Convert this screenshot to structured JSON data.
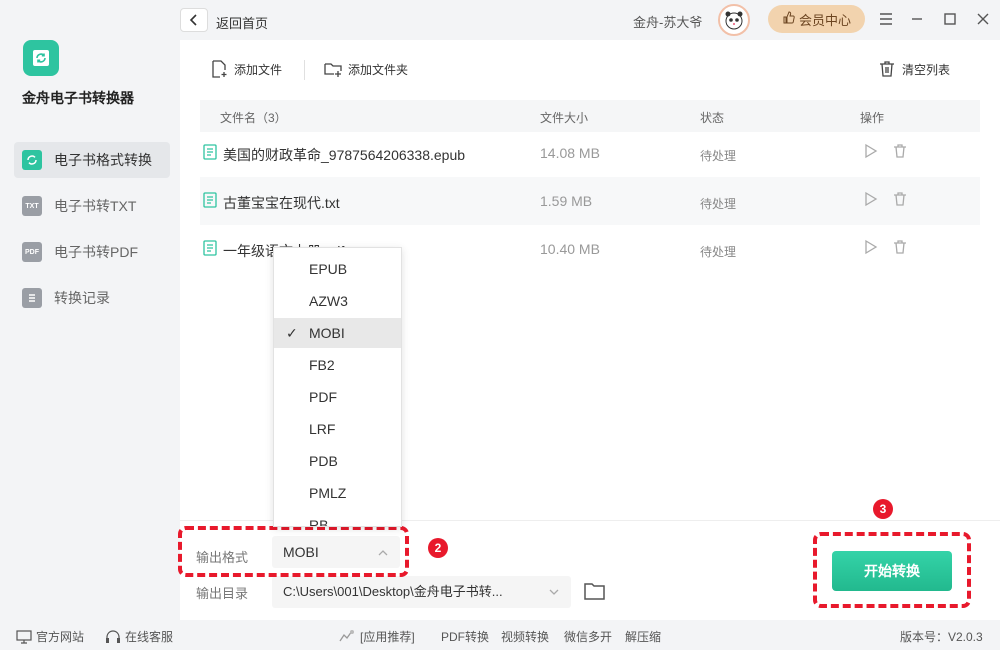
{
  "app": {
    "name": "金舟电子书转换器"
  },
  "sidebar": {
    "items": [
      {
        "label": "电子书格式转换",
        "icon": "refresh-icon",
        "active": true
      },
      {
        "label": "电子书转TXT",
        "icon": "txt-icon",
        "badge": "TXT"
      },
      {
        "label": "电子书转PDF",
        "icon": "pdf-icon",
        "badge": "PDF"
      },
      {
        "label": "转换记录",
        "icon": "history-icon"
      }
    ]
  },
  "topbar": {
    "back_label": "返回首页",
    "username": "金舟-苏大爷",
    "vip_label": "会员中心"
  },
  "toolbar": {
    "add_file": "添加文件",
    "add_folder": "添加文件夹",
    "clear_list": "清空列表"
  },
  "table": {
    "headers": {
      "name": "文件名（3）",
      "size": "文件大小",
      "status": "状态",
      "ops": "操作"
    },
    "rows": [
      {
        "name": "美国的财政革命_9787564206338.epub",
        "size": "14.08 MB",
        "status": "待处理"
      },
      {
        "name": "古董宝宝在现代.txt",
        "size": "1.59 MB",
        "status": "待处理"
      },
      {
        "name": "一年级语文上册.pdf",
        "size": "10.40 MB",
        "status": "待处理"
      }
    ]
  },
  "format_dropdown": {
    "options": [
      "EPUB",
      "AZW3",
      "MOBI",
      "FB2",
      "PDF",
      "LRF",
      "PDB",
      "PMLZ",
      "RB"
    ],
    "selected": "MOBI",
    "check": "✓"
  },
  "output": {
    "format_label": "输出格式",
    "format_value": "MOBI",
    "dir_label": "输出目录",
    "dir_value": "C:\\Users\\001\\Desktop\\金舟电子书转..."
  },
  "start_button": "开始转换",
  "annotations": {
    "badge2": "2",
    "badge3": "3",
    "color": "#e8192c"
  },
  "footer": {
    "website": "官方网站",
    "support": "在线客服",
    "apps": "[应用推荐]",
    "links": [
      "PDF转换",
      "视频转换",
      "微信多开",
      "解压缩"
    ],
    "version": "版本号：V2.0.3"
  },
  "colors": {
    "accent": "#2ec4a0",
    "vip": "#f2d3ae"
  }
}
